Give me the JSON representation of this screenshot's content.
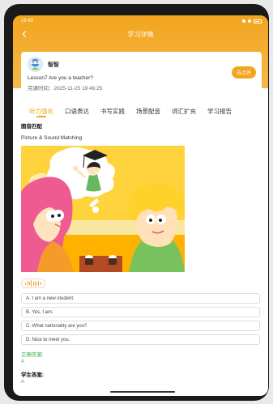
{
  "statusbar": {
    "time": "16:43"
  },
  "nav": {
    "title": "学习详情"
  },
  "card": {
    "username": "智智",
    "lesson_title": "Lesson7 Are you a teacher?",
    "finish_time": "完课时间：2025-11-25 19:46:25",
    "comment_button": "去点评"
  },
  "tabs": [
    {
      "label": "听力强化",
      "active": true
    },
    {
      "label": "口语表达",
      "active": false
    },
    {
      "label": "书写实践",
      "active": false
    },
    {
      "label": "场景配音",
      "active": false
    },
    {
      "label": "词汇扩充",
      "active": false
    },
    {
      "label": "学习报告",
      "active": false
    }
  ],
  "section": {
    "title": "图音匹配",
    "question": "Picture & Sound Matching"
  },
  "options": [
    "A. I am a new student.",
    "B. Yes, I am.",
    "C. What nationality are you?",
    "D. Nice to meet you."
  ],
  "answer": {
    "label": "正确答案:",
    "value": "A"
  },
  "student": {
    "label": "学生答案:",
    "value": "A"
  },
  "colors": {
    "accent": "#f3a51e",
    "correct": "#39b54a"
  }
}
